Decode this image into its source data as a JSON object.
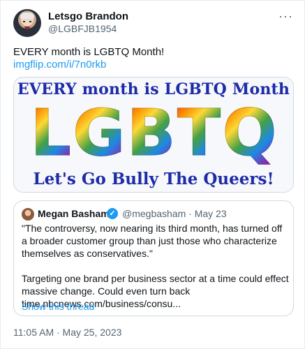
{
  "author": {
    "display_name": "Letsgo Brandon",
    "handle": "@LGBFJB1954"
  },
  "tweet": {
    "text": "EVERY month is LGBTQ Month!",
    "link": "imgflip.com/i/7n0rkb",
    "timestamp": "11:05 AM · May 25, 2023"
  },
  "image": {
    "top_text": "EVERY month is LGBTQ Month",
    "big_letters": [
      "L",
      "G",
      "B",
      "T",
      "Q"
    ],
    "bottom_text": "Let's Go Bully The Queers!"
  },
  "quoted": {
    "display_name": "Megan Basham",
    "handle_date": "@megbasham · May 23",
    "paragraph1": "\"The controversy, now nearing its third month, has turned off a broader customer group than just those who characterize themselves as conservatives.\"",
    "paragraph2": "Targeting one brand per business sector at a time could effect massive change. Could even turn back time.nbcnews.com/business/consu...",
    "show_thread": "Show this thread"
  },
  "icons": {
    "more": "more-options-icon",
    "verified": "verified-badge-icon"
  },
  "colors": {
    "link": "#1d9bf0",
    "secondary_text": "#536471",
    "border": "#cfd9de",
    "meme_text": "#1d2ba8"
  }
}
